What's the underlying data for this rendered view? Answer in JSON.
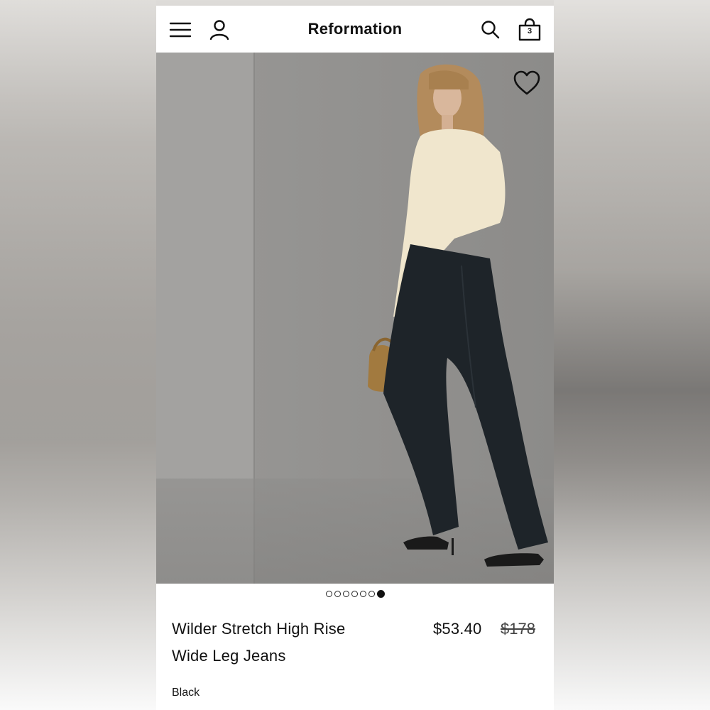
{
  "header": {
    "brand": "Reformation",
    "bag_count": "3",
    "icons": [
      "menu-icon",
      "account-icon",
      "search-icon",
      "shopping-bag-icon"
    ]
  },
  "product": {
    "name_line1": "Wilder Stretch High Rise",
    "name_line2": "Wide Leg Jeans",
    "sale_price": "$53.40",
    "original_price": "$178",
    "color": "Black"
  },
  "carousel": {
    "total": 7,
    "active_index": 6
  },
  "colors": {
    "text": "#111111",
    "background": "#ffffff",
    "photo_backdrop": "#8f8e8c"
  }
}
